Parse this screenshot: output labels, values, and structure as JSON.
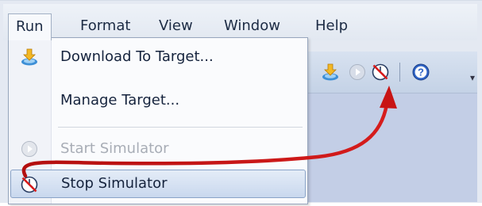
{
  "menubar": {
    "items": [
      {
        "label": "Run",
        "active": true
      },
      {
        "label": "Format"
      },
      {
        "label": "View"
      },
      {
        "label": "Window"
      },
      {
        "label": "Help"
      }
    ]
  },
  "run_menu": {
    "items": [
      {
        "label": "Download To Target...",
        "icon": "download-icon",
        "enabled": true
      },
      {
        "label": "Manage Target...",
        "enabled": true
      },
      {
        "label": "Start Simulator",
        "icon": "play-icon",
        "enabled": false
      },
      {
        "label": "Stop Simulator",
        "icon": "stop-simulator-icon",
        "enabled": true,
        "highlighted": true
      }
    ]
  },
  "toolbar": {
    "buttons": [
      {
        "icon": "download-icon",
        "enabled": true
      },
      {
        "icon": "play-icon",
        "enabled": false
      },
      {
        "icon": "stop-simulator-icon",
        "enabled": true
      },
      {
        "icon": "help-icon",
        "enabled": true
      }
    ]
  },
  "annotation": {
    "type": "curved-arrow",
    "color": "#c41414",
    "from": "Stop Simulator menu item",
    "to": "stop-simulator toolbar button"
  }
}
